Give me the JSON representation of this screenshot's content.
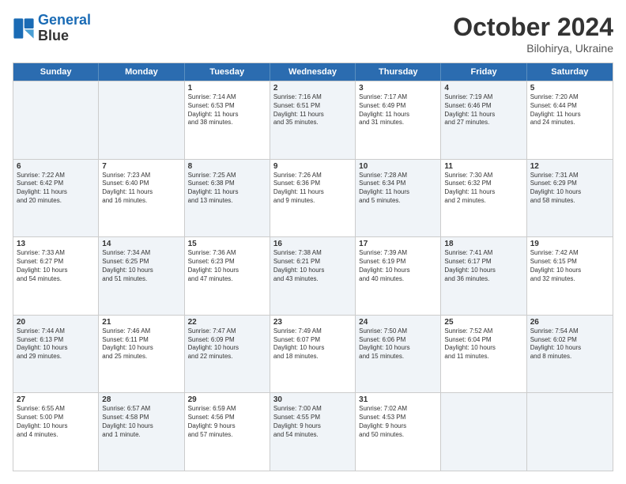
{
  "logo": {
    "line1": "General",
    "line2": "Blue"
  },
  "title": "October 2024",
  "subtitle": "Bilohirya, Ukraine",
  "header_days": [
    "Sunday",
    "Monday",
    "Tuesday",
    "Wednesday",
    "Thursday",
    "Friday",
    "Saturday"
  ],
  "weeks": [
    [
      {
        "day": "",
        "info": "",
        "shaded": true
      },
      {
        "day": "",
        "info": "",
        "shaded": true
      },
      {
        "day": "1",
        "info": "Sunrise: 7:14 AM\nSunset: 6:53 PM\nDaylight: 11 hours\nand 38 minutes.",
        "shaded": false
      },
      {
        "day": "2",
        "info": "Sunrise: 7:16 AM\nSunset: 6:51 PM\nDaylight: 11 hours\nand 35 minutes.",
        "shaded": true
      },
      {
        "day": "3",
        "info": "Sunrise: 7:17 AM\nSunset: 6:49 PM\nDaylight: 11 hours\nand 31 minutes.",
        "shaded": false
      },
      {
        "day": "4",
        "info": "Sunrise: 7:19 AM\nSunset: 6:46 PM\nDaylight: 11 hours\nand 27 minutes.",
        "shaded": true
      },
      {
        "day": "5",
        "info": "Sunrise: 7:20 AM\nSunset: 6:44 PM\nDaylight: 11 hours\nand 24 minutes.",
        "shaded": false
      }
    ],
    [
      {
        "day": "6",
        "info": "Sunrise: 7:22 AM\nSunset: 6:42 PM\nDaylight: 11 hours\nand 20 minutes.",
        "shaded": true
      },
      {
        "day": "7",
        "info": "Sunrise: 7:23 AM\nSunset: 6:40 PM\nDaylight: 11 hours\nand 16 minutes.",
        "shaded": false
      },
      {
        "day": "8",
        "info": "Sunrise: 7:25 AM\nSunset: 6:38 PM\nDaylight: 11 hours\nand 13 minutes.",
        "shaded": true
      },
      {
        "day": "9",
        "info": "Sunrise: 7:26 AM\nSunset: 6:36 PM\nDaylight: 11 hours\nand 9 minutes.",
        "shaded": false
      },
      {
        "day": "10",
        "info": "Sunrise: 7:28 AM\nSunset: 6:34 PM\nDaylight: 11 hours\nand 5 minutes.",
        "shaded": true
      },
      {
        "day": "11",
        "info": "Sunrise: 7:30 AM\nSunset: 6:32 PM\nDaylight: 11 hours\nand 2 minutes.",
        "shaded": false
      },
      {
        "day": "12",
        "info": "Sunrise: 7:31 AM\nSunset: 6:29 PM\nDaylight: 10 hours\nand 58 minutes.",
        "shaded": true
      }
    ],
    [
      {
        "day": "13",
        "info": "Sunrise: 7:33 AM\nSunset: 6:27 PM\nDaylight: 10 hours\nand 54 minutes.",
        "shaded": false
      },
      {
        "day": "14",
        "info": "Sunrise: 7:34 AM\nSunset: 6:25 PM\nDaylight: 10 hours\nand 51 minutes.",
        "shaded": true
      },
      {
        "day": "15",
        "info": "Sunrise: 7:36 AM\nSunset: 6:23 PM\nDaylight: 10 hours\nand 47 minutes.",
        "shaded": false
      },
      {
        "day": "16",
        "info": "Sunrise: 7:38 AM\nSunset: 6:21 PM\nDaylight: 10 hours\nand 43 minutes.",
        "shaded": true
      },
      {
        "day": "17",
        "info": "Sunrise: 7:39 AM\nSunset: 6:19 PM\nDaylight: 10 hours\nand 40 minutes.",
        "shaded": false
      },
      {
        "day": "18",
        "info": "Sunrise: 7:41 AM\nSunset: 6:17 PM\nDaylight: 10 hours\nand 36 minutes.",
        "shaded": true
      },
      {
        "day": "19",
        "info": "Sunrise: 7:42 AM\nSunset: 6:15 PM\nDaylight: 10 hours\nand 32 minutes.",
        "shaded": false
      }
    ],
    [
      {
        "day": "20",
        "info": "Sunrise: 7:44 AM\nSunset: 6:13 PM\nDaylight: 10 hours\nand 29 minutes.",
        "shaded": true
      },
      {
        "day": "21",
        "info": "Sunrise: 7:46 AM\nSunset: 6:11 PM\nDaylight: 10 hours\nand 25 minutes.",
        "shaded": false
      },
      {
        "day": "22",
        "info": "Sunrise: 7:47 AM\nSunset: 6:09 PM\nDaylight: 10 hours\nand 22 minutes.",
        "shaded": true
      },
      {
        "day": "23",
        "info": "Sunrise: 7:49 AM\nSunset: 6:07 PM\nDaylight: 10 hours\nand 18 minutes.",
        "shaded": false
      },
      {
        "day": "24",
        "info": "Sunrise: 7:50 AM\nSunset: 6:06 PM\nDaylight: 10 hours\nand 15 minutes.",
        "shaded": true
      },
      {
        "day": "25",
        "info": "Sunrise: 7:52 AM\nSunset: 6:04 PM\nDaylight: 10 hours\nand 11 minutes.",
        "shaded": false
      },
      {
        "day": "26",
        "info": "Sunrise: 7:54 AM\nSunset: 6:02 PM\nDaylight: 10 hours\nand 8 minutes.",
        "shaded": true
      }
    ],
    [
      {
        "day": "27",
        "info": "Sunrise: 6:55 AM\nSunset: 5:00 PM\nDaylight: 10 hours\nand 4 minutes.",
        "shaded": false
      },
      {
        "day": "28",
        "info": "Sunrise: 6:57 AM\nSunset: 4:58 PM\nDaylight: 10 hours\nand 1 minute.",
        "shaded": true
      },
      {
        "day": "29",
        "info": "Sunrise: 6:59 AM\nSunset: 4:56 PM\nDaylight: 9 hours\nand 57 minutes.",
        "shaded": false
      },
      {
        "day": "30",
        "info": "Sunrise: 7:00 AM\nSunset: 4:55 PM\nDaylight: 9 hours\nand 54 minutes.",
        "shaded": true
      },
      {
        "day": "31",
        "info": "Sunrise: 7:02 AM\nSunset: 4:53 PM\nDaylight: 9 hours\nand 50 minutes.",
        "shaded": false
      },
      {
        "day": "",
        "info": "",
        "shaded": true
      },
      {
        "day": "",
        "info": "",
        "shaded": true
      }
    ]
  ]
}
